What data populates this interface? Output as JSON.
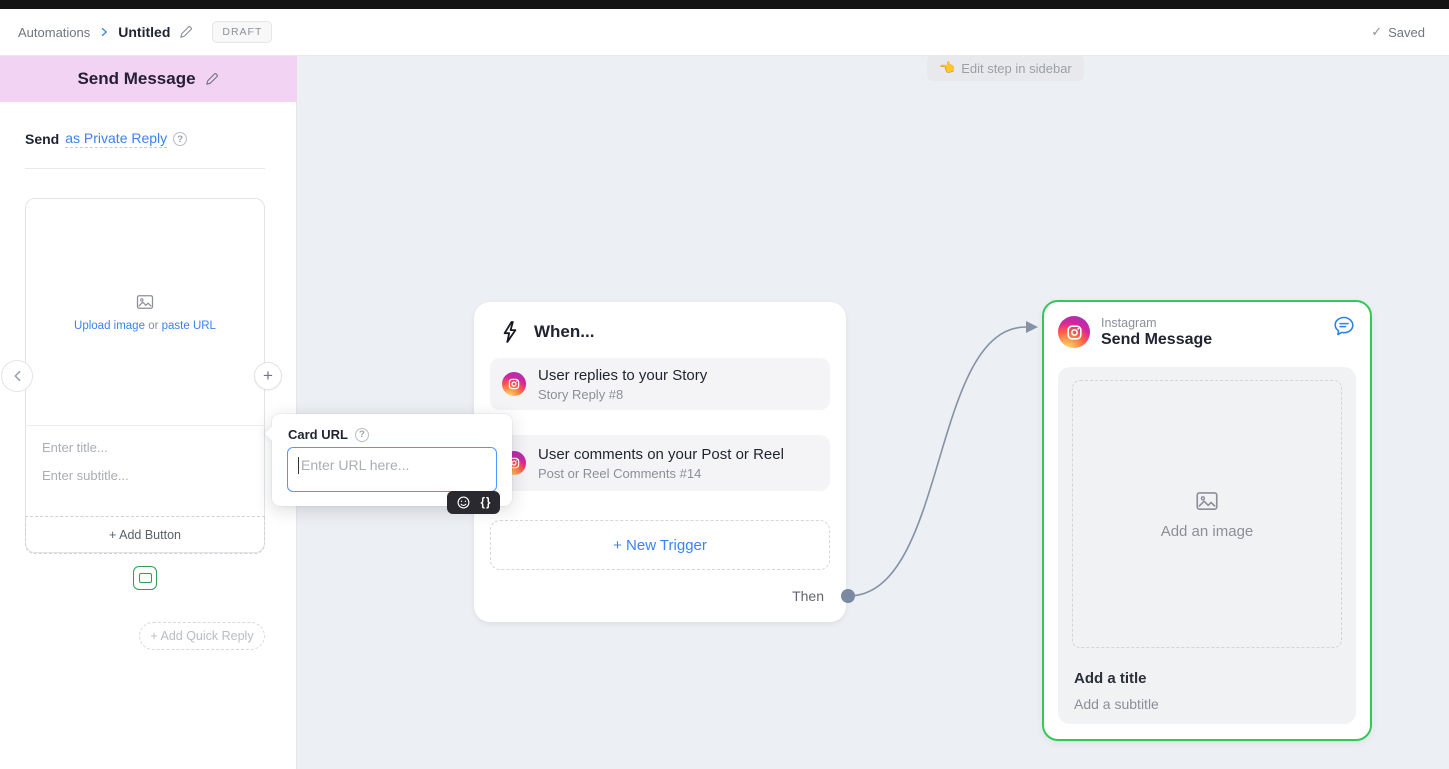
{
  "topbar": {
    "breadcrumb_root": "Automations",
    "breadcrumb_current": "Untitled",
    "draft_badge": "DRAFT",
    "saved_label": "Saved"
  },
  "icons": {
    "question": "?",
    "plus": "+",
    "check": "✓",
    "braces": "{}",
    "hint_emoji": "👈"
  },
  "sidebar": {
    "title": "Send Message",
    "send_prefix": "Send",
    "send_mode_link": "as Private Reply",
    "card": {
      "upload_link": "Upload image",
      "or_text": "or",
      "paste_link": "paste URL",
      "title_placeholder": "Enter title...",
      "subtitle_placeholder": "Enter subtitle...",
      "add_button_label": "+ Add Button"
    },
    "add_quick_reply_label": "+ Add Quick Reply"
  },
  "popover": {
    "label": "Card URL",
    "input_value": "",
    "input_placeholder": "Enter URL here..."
  },
  "canvas": {
    "hint_text": "Edit step in sidebar",
    "when_card": {
      "title": "When...",
      "triggers": [
        {
          "title": "User replies to your Story",
          "subtitle": "Story Reply #8"
        },
        {
          "title": "User comments on your Post or Reel",
          "subtitle": "Post or Reel Comments #14"
        }
      ],
      "new_trigger_label": "+ New Trigger",
      "then_label": "Then"
    },
    "send_card": {
      "app_name": "Instagram",
      "title": "Send Message",
      "image_placeholder": "Add an image",
      "title_placeholder": "Add a title",
      "subtitle_placeholder": "Add a subtitle"
    }
  },
  "colors": {
    "accent_green": "#34c759",
    "link_blue": "#3b82f6",
    "header_pink": "#f2d3f4",
    "connector": "#8492a6"
  }
}
